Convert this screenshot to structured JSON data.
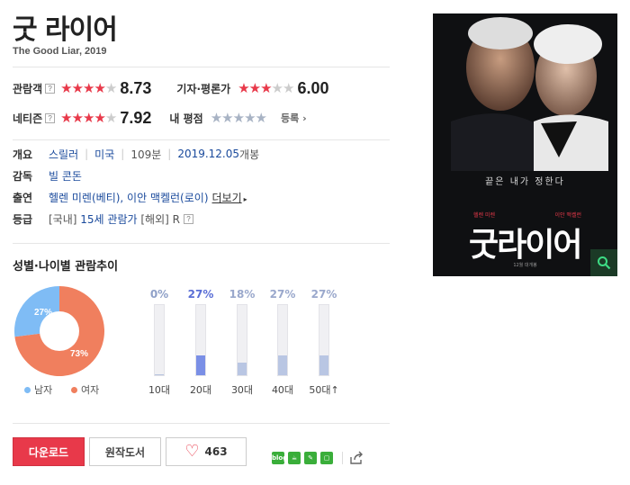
{
  "header": {
    "title": "굿 라이어",
    "subtitle": "The Good Liar, 2019"
  },
  "ratings": {
    "audience": {
      "label": "관람객",
      "score": "8.73"
    },
    "critic": {
      "label": "기자·평론가",
      "score": "6.00"
    },
    "netizen": {
      "label": "네티즌",
      "score": "7.92"
    },
    "mine": {
      "label": "내 평점",
      "register": "등록"
    },
    "help_icon": "?"
  },
  "info": {
    "summary_label": "개요",
    "genre": "스릴러",
    "country": "미국",
    "runtime": "109분",
    "release": "2019.12.05",
    "release_suffix": "개봉",
    "director_label": "감독",
    "director": "빌 콘돈",
    "cast_label": "출연",
    "cast": "헬렌 미렌(베티), 이안 맥켈런(로이)",
    "more": "더보기",
    "grade_label": "등급",
    "grade_kr_prefix": "[국내]",
    "grade_kr": "15세 관람가",
    "grade_intl": "[해외] R"
  },
  "demographics": {
    "title": "성별·나이별 관람추이",
    "gender": {
      "male_pct": "27%",
      "female_pct": "73%",
      "male_label": "남자",
      "female_label": "여자",
      "male_color": "#7fbcf5",
      "female_color": "#f07f5e"
    },
    "ages": [
      {
        "pct": "0%",
        "label": "10대",
        "value": 0,
        "color": "#b6c3de",
        "pct_color": "#8fa0c8"
      },
      {
        "pct": "27%",
        "label": "20대",
        "value": 27,
        "color": "#7a8fe6",
        "pct_color": "#5b6fd6"
      },
      {
        "pct": "18%",
        "label": "30대",
        "value": 18,
        "color": "#b9c6e3",
        "pct_color": "#9aa8cc"
      },
      {
        "pct": "27%",
        "label": "40대",
        "value": 27,
        "color": "#b9c6e3",
        "pct_color": "#9aa8cc"
      },
      {
        "pct": "27%",
        "label": "50대↑",
        "value": 27,
        "color": "#b9c6e3",
        "pct_color": "#9aa8cc"
      }
    ]
  },
  "actions": {
    "download": "다운로드",
    "book": "원작도서",
    "likes": "463"
  },
  "poster": {
    "tagline": "끝은 내가 정한다",
    "title": "굿라이어",
    "name_left": "헬렌 미렌",
    "name_right": "이안 맥켈런",
    "footer": "12월 대개봉"
  }
}
